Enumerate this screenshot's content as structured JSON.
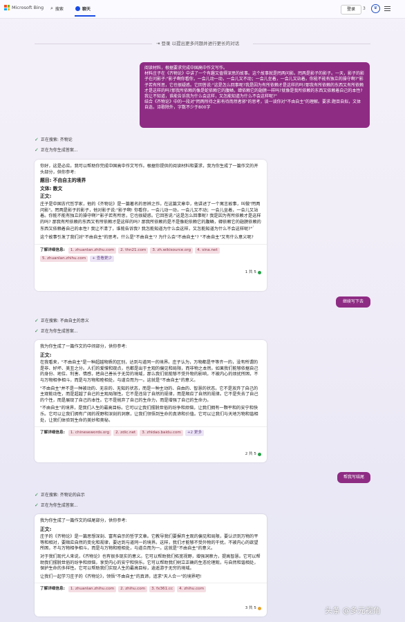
{
  "header": {
    "brand": "Microsoft Bing",
    "tabs": [
      {
        "label": "搜索"
      },
      {
        "label": "聊天"
      }
    ],
    "login": "登录",
    "rewards_count": "3"
  },
  "signin_note": "登录 以提出更多问题并进行更长的对话",
  "messages": {
    "user1": {
      "lines": [
        "阅读材料，根据要求完成中国高中作文写作。",
        "材料庄子在《齐物论》中讲了一个有趣又值得深思的故事。这个故事就是罔两问影。罔两是影子的影子。一天，影子的影子在问影子:\"影子啊你看你，一会儿动一动，一会儿又不动；一会儿坐着，一会儿又站着。你能不能有独立的操守啊?\"影子若有所思，它也很疑惑。它回答说:\"这是怎么回事呢?我是因为有所依赖才是这样的吗?那我有所依赖的东西又有所依赖才是这样的吗?那我所依赖的像是蛇依赖它的腹鳞，蝉依赖它的翅膀一样吗?就像是我所依赖的东西又依赖着自己的本性?我让不知道，谁能告诉我为什么会这样，又怎能知道为什么不会这样呢?\"",
        "结合《齐物论》中的一段对\"罔两所待之影有待而然者邪\"的思考，谈一谈你对\"不由自主\"的理解。要求:题目自拟，文体自选，诗歌除外，字数不少于800字"
      ]
    },
    "status1": [
      "正在搜索: 齐物论",
      "正在为你生成答案..."
    ],
    "bot1": {
      "intro": "你好，这是必应。我可以帮助你完成中国高中作文写作。根据你提供的阅读材料和要求，我为你生成了一篇作文的开头部分，供你参考:",
      "title_line": "题目: 不由自主的境界",
      "genre_line": "文体: 散文",
      "body_label": "正文:",
      "body": "庄子是中国古代哲学家，他的《齐物论》是一篇著名的思辨之作。在这篇文章中，他讲述了一个寓言故事，叫做\"罔两问影\"。罔两是影子的影子，他对影子说:\"影子啊! 你看你，一会儿动一动，一会儿又不动；一会儿坐着，一会儿又站着。你能不能有独立的操守啊?\"影子若有所思，它也很疑惑。它回答说:\"这是怎么回事呢? 我是因为有所依赖才是这样的吗? 那我有所依赖的东西又有所依赖才是这样的吗? 那我所依赖的是不是像蛇依赖它的腹鳞，蝉依赖它的翅膀依赖的东西又依赖着自己的本性? 我让不清了，谁能告诉我? 我怎能知道为什么会这样，又怎能知道为什么不会这样呢?\"",
      "question": "这个故事引发了我们对\"不由自主\"的思考。什么是\"不由自主\"? 为什么会\"不由自主\"? \"不由自主\"又有什么意义呢?",
      "refs_label": "了解详细信息:",
      "refs": [
        "1. zhuanlan.zhihu.com",
        "2. thn21.com",
        "3. zh.wikisource.org",
        "4. sina.net",
        "5. zhuanlan.zhihu.com",
        "+ 查看更少"
      ],
      "count": "1 共 5"
    },
    "user2": "继续写下去",
    "status2": [
      "正在搜索: 不由自主的意义",
      "正在为你生成答案..."
    ],
    "bot2": {
      "intro": "我为你生成了一篇作文的中间部分，供你参考:",
      "body_label": "正文:",
      "paras": [
        "在我看来，\"不由自主\"是一种超越物质的区别，达到与道同一的境界。庄子认为，万物都是平等齐一的，没有所谓的是非、好坏、美丑之分。人们的爱憎和观点，也都是出于主观的偏见和局限，而非物之本然。如果我们能够依据自己的身份、地位、利害、情感，把自己善长于无劳的境域，那么我们就能够不受外物的影响，不被内心的烦扰所困，不与万物相争相斗，而是与万物和睦相处，与道合而为一。这就是\"不由自主\"的意义。",
        "\"不由自主\"并不是一种被动的、无奈的、无知的状态，而是一种主动的、自由的、智慧的状态。它不是放弃了自己的主观能动性，而是超越了自己的主观局限性。它不是违背了自然的规律，而是顺应了自然的规律。它不是失去了自己的个性，而是展现了自己的本性。它不是抛弃了自己的生命力，而是增强了自己的生命力。",
        "\"不由自主\"的境界，是我们人生的最高目标。它可以让我们摆脱世俗的纷争和烦恼，让我们拥有一颗平和的安宁和快乐。它可以让我们拥有广阔的视野和深刻的洞察，让我们领悟到生命的真谛和价值。它可以让我们与天地万物和谐相处，让我们体验到生命的美妙和奥秘。"
      ],
      "refs_label": "了解详细信息:",
      "refs": [
        "1. chinesewords.org",
        "2. zdic.net",
        "3. zhidao.baidu.com",
        "+2 更多"
      ],
      "count": "2 共 5"
    },
    "user3": "帮我写结尾",
    "status3": [
      "正在搜索: 齐物论的启示",
      "正在为你生成答案..."
    ],
    "bot3": {
      "intro": "我为你生成了一篇作文的结尾部分，供你参考:",
      "body_label": "正文:",
      "paras": [
        "庄子的《齐物论》是一篇思想深刻、富有启示的哲学文章。它教导我们要摒弃主观的偏见和局限，要认识到万物的平等和相对，要顺应自然的变化和规律，要达到与道同一的境界。这样，我们才能够不受外物的干扰，不被内心的欲望所困，不与万物相争相斗，而是与万物和睦相处，与道合而为一。这就是\"不由自主\"的意义。",
        "对于我们现代人来说，《齐物论》也有很多现实的意义。它可以帮助我们拓宽视野，增强洞察力，提高智慧。它可以帮助我们摆脱世俗的纷争和烦恼，享受内心的安宁和快乐。它可以帮助我们树立正确的生态伦理观，与自然和谐相处，保护生命的多样性。它可以帮助我们实现人生的最高目标，逍遥游于无穷的境域。",
        "让我们一起学习庄子的《齐物论》，领悟\"不由自主\"的真谛，追求\"天人合一\"的境界吧!"
      ],
      "refs_label": "了解详细信息:",
      "refs": [
        "1. zhuanlan.zhihu.com",
        "2. zhihu.com",
        "3. fx361.cc",
        "4. zhihu.com"
      ],
      "count": "3 共 5"
    }
  },
  "watermark": "头条 @多元视角",
  "colors": {
    "user_bubble": "#8e2c84",
    "ref_bg": "#f4dde3",
    "accent": "#174ae4"
  }
}
